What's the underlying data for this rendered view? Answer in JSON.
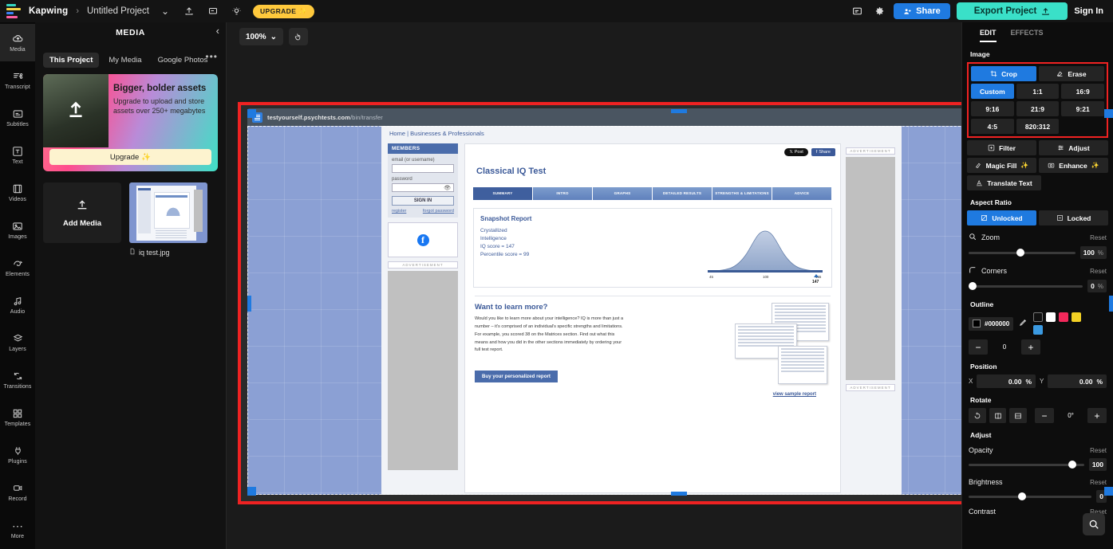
{
  "topbar": {
    "brand": "Kapwing",
    "separator": "›",
    "project": "Untitled Project",
    "chevron": "⌄",
    "upload_icon": "upload-icon",
    "comment_icon": "comment-icon",
    "idea_icon": "idea-icon",
    "upgrade": "UPGRADE",
    "upgrade_spark": "✨",
    "feedback_icon": "⌸",
    "settings_icon": "⚙",
    "share": "Share",
    "share_icon": "☺",
    "export": "Export Project",
    "export_icon": "⇧",
    "signin": "Sign In"
  },
  "rail": {
    "items": [
      {
        "label": "Media",
        "icon": "☁",
        "icon_name": "cloud-upload-icon",
        "active": true
      },
      {
        "label": "Transcript",
        "icon": "≡",
        "icon_name": "transcript-icon",
        "active": false
      },
      {
        "label": "Subtitles",
        "icon": "⊟",
        "icon_name": "subtitles-icon",
        "active": false
      },
      {
        "label": "Text",
        "icon": "✎",
        "icon_name": "text-icon",
        "active": false
      },
      {
        "label": "Videos",
        "icon": "☷",
        "icon_name": "video-film-icon",
        "active": false
      },
      {
        "label": "Images",
        "icon": "⛰",
        "icon_name": "image-icon",
        "active": false
      },
      {
        "label": "Elements",
        "icon": "♢",
        "icon_name": "elements-icon",
        "active": false
      },
      {
        "label": "Audio",
        "icon": "♫",
        "icon_name": "audio-note-icon",
        "active": false
      },
      {
        "label": "Layers",
        "icon": "☰",
        "icon_name": "layers-icon",
        "active": false
      },
      {
        "label": "Transitions",
        "icon": "↻",
        "icon_name": "transitions-icon",
        "active": false
      },
      {
        "label": "Templates",
        "icon": "⊞",
        "icon_name": "templates-icon",
        "active": false
      },
      {
        "label": "Plugins",
        "icon": "⚡",
        "icon_name": "plugins-icon",
        "active": false
      },
      {
        "label": "Record",
        "icon": "▣",
        "icon_name": "record-camera-icon",
        "active": false
      },
      {
        "label": "More",
        "icon": "⋯",
        "icon_name": "more-icon",
        "active": false
      }
    ]
  },
  "media_panel": {
    "title": "MEDIA",
    "collapse_icon": "‹",
    "more_icon": "•••",
    "tabs": [
      {
        "label": "This Project",
        "active": true
      },
      {
        "label": "My Media",
        "active": false
      },
      {
        "label": "Google Photos",
        "active": false
      }
    ],
    "promo": {
      "heading": "Bigger, bolder assets",
      "body": "Upgrade to upload and store assets over 250+ megabytes",
      "button": "Upgrade",
      "button_spark": "✨",
      "upload_icon": "↑"
    },
    "add_media": {
      "label": "Add Media",
      "icon": "⇧"
    },
    "asset": {
      "name": "iq test.jpg",
      "doc_icon": "☷"
    }
  },
  "canvas": {
    "zoom_level": "100%",
    "zoom_chevron": "⌄",
    "cursor_icon": "☝",
    "browser": {
      "url_main": "testyourself.psychtests.com",
      "url_path": "/bin/transfer",
      "icons": [
        "☆",
        "⧉",
        "●",
        "⋮"
      ]
    },
    "site": {
      "nav_home": "Home",
      "nav_sep": "|",
      "nav_biz": "Businesses & Professionals",
      "members_header": "MEMBERS",
      "email_label": "email (or username)",
      "password_label": "password",
      "signin_button": "SIGN IN",
      "link_register": "register",
      "link_forgot": "forgot password",
      "advertisement": "ADVERTISEMENT",
      "x_post": "Post",
      "fb_share": "Share",
      "page_title": "Classical IQ Test",
      "tabs": [
        {
          "label": "SUMMARY",
          "active": true
        },
        {
          "label": "INTRO",
          "active": false
        },
        {
          "label": "GRAPHS",
          "active": false
        },
        {
          "label": "DETAILED RESULTS",
          "active": false
        },
        {
          "label": "STRENGTHS & LIMITATIONS",
          "active": false
        },
        {
          "label": "ADVICE",
          "active": false
        }
      ],
      "snapshot": {
        "heading": "Snapshot Report",
        "line1": "Crystallized",
        "line2": "Intelligence",
        "line3": "IQ score = 147",
        "line4": "Percentile score = 99"
      },
      "learn": {
        "heading": "Want to learn more?",
        "body": "Would you like to learn more about your intelligence? IQ is more than just a number – it's comprised of an individual's specific strengths and limitations. For example, you scored 38 on the Matrices section. Find out what this means and how you did in the other sections immediately by ordering your full test report.",
        "buy_button": "Buy your personalized report",
        "sample_link": "view sample report"
      }
    }
  },
  "chart_data": {
    "type": "line",
    "title": "Crystallized Intelligence bell curve",
    "xlabel": "",
    "ylabel": "",
    "xlim": [
      45,
      155
    ],
    "tick_labels": [
      "45",
      "100",
      "155"
    ],
    "marker_label": "147",
    "marker_value": 147,
    "iq_score": 147,
    "percentile_score": 99,
    "grid": false
  },
  "right_panel": {
    "tabs": [
      {
        "label": "EDIT",
        "active": true
      },
      {
        "label": "EFFECTS",
        "active": false
      }
    ],
    "image_section": "Image",
    "crop": {
      "label": "Crop",
      "icon": "⌗"
    },
    "erase": {
      "label": "Erase",
      "icon": "✐"
    },
    "ratios": [
      {
        "label": "Custom",
        "active": true
      },
      {
        "label": "1:1",
        "active": false
      },
      {
        "label": "16:9",
        "active": false
      },
      {
        "label": "9:16",
        "active": false
      },
      {
        "label": "21:9",
        "active": false
      },
      {
        "label": "9:21",
        "active": false
      },
      {
        "label": "4:5",
        "active": false
      },
      {
        "label": "820:312",
        "active": false
      }
    ],
    "filter": {
      "label": "Filter",
      "icon": "❁"
    },
    "adjust_btn": {
      "label": "Adjust",
      "icon": "≡"
    },
    "magic_fill": {
      "label": "Magic Fill",
      "icon": "✒",
      "spark": "✨"
    },
    "enhance": {
      "label": "Enhance",
      "icon": "⊙",
      "spark": "✨"
    },
    "translate": {
      "label": "Translate Text",
      "icon": "A"
    },
    "aspect_ratio_label": "Aspect Ratio",
    "unlocked": {
      "label": "Unlocked",
      "icon": "⛶",
      "active": true
    },
    "locked": {
      "label": "Locked",
      "icon": "▣",
      "active": false
    },
    "zoom": {
      "label": "Zoom",
      "icon": "⌕",
      "reset": "Reset",
      "value": "100",
      "unit": "%",
      "pos": 45
    },
    "corners": {
      "label": "Corners",
      "icon": "◜",
      "reset": "Reset",
      "value": "0",
      "unit": "%",
      "pos": 0
    },
    "outline": {
      "label": "Outline",
      "hex": "#000000",
      "pipette_icon": "✒",
      "swatches": [
        "#111111",
        "#ffffff",
        "#f2295b",
        "#f2d024",
        "#3b9ae1"
      ],
      "width_value": "0",
      "minus": "−",
      "plus": "+"
    },
    "position": {
      "label": "Position",
      "x_label": "X",
      "x_value": "0.00",
      "y_label": "Y",
      "y_value": "0.00",
      "unit": "%"
    },
    "rotate": {
      "label": "Rotate",
      "buttons": [
        "↺",
        "◑",
        "⊖"
      ],
      "minus": "−",
      "value": "0°",
      "plus": "+"
    },
    "adjust": {
      "label": "Adjust",
      "opacity": {
        "label": "Opacity",
        "reset": "Reset",
        "value": "100",
        "pos": 86
      },
      "brightness": {
        "label": "Brightness",
        "reset": "Reset",
        "value": "0",
        "pos": 40
      },
      "contrast": {
        "label": "Contrast",
        "reset": "Reset"
      }
    },
    "magnify_icon": "⌕"
  }
}
